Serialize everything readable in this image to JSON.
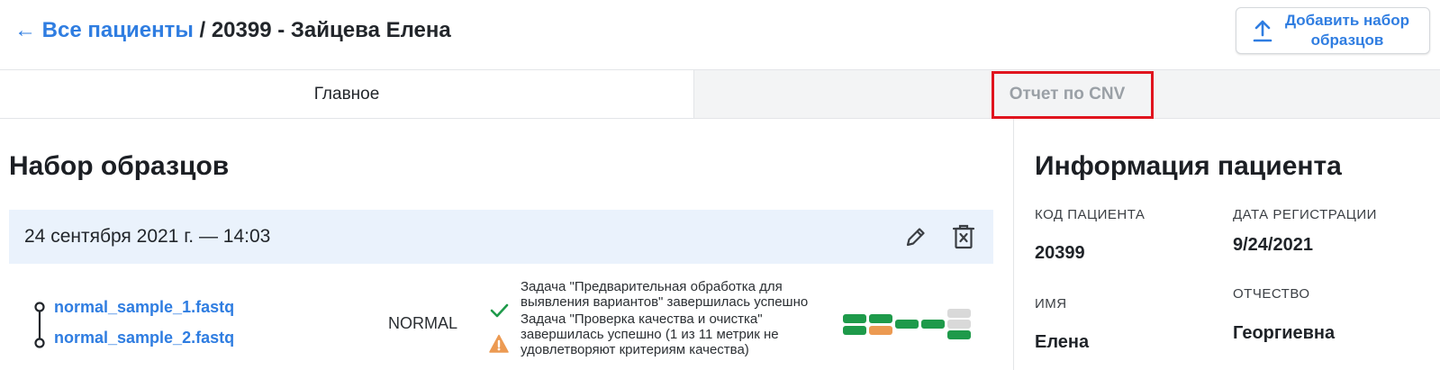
{
  "header": {
    "back_link": "← Все пациенты",
    "separator": " / ",
    "patient_title": "20399 - Зайцева Елена",
    "add_sample_set_button": "Добавить набор образцов"
  },
  "tabs": [
    {
      "label": "Главное",
      "active": true
    },
    {
      "label": "Отчет по CNV",
      "active": false
    }
  ],
  "sample_sets": {
    "title": "Набор образцов",
    "sets": [
      {
        "date": "24 сентября 2021 г. — 14:03",
        "files": [
          "normal_sample_1.fastq",
          "normal_sample_2.fastq"
        ],
        "sample_type": "NORMAL",
        "tasks": [
          {
            "status": "success",
            "icon": "check-icon",
            "text": "Задача \"Предварительная обработка для выявления вариантов\" завершилась успешно"
          },
          {
            "status": "warning",
            "icon": "warning-icon",
            "text": "Задача \"Проверка качества и очистка\" завершилась успешно (1 из 11 метрик не удовлетворяют критериям качества)"
          }
        ],
        "qc_metrics": [
          "pass",
          "pass",
          "pass",
          "warn",
          "pass",
          "pass",
          "na",
          "na",
          "pass",
          "pass",
          "pass"
        ]
      }
    ]
  },
  "patient_info": {
    "title": "Информация пациента",
    "fields": {
      "code": {
        "label": "КОД ПАЦИЕНТА",
        "value": "20399"
      },
      "registration_date": {
        "label": "ДАТА РЕГИСТРАЦИИ",
        "value": "9/24/2021"
      },
      "first_name": {
        "label": "ИМЯ",
        "value": "Елена"
      },
      "patronymic": {
        "label": "ОТЧЕСТВО",
        "value": "Георгиевна"
      }
    }
  },
  "colors": {
    "accent": "#2f7de1",
    "pass": "#1e9a4a",
    "warn": "#ec9a52",
    "na": "#d9d9d9",
    "highlight": "#e0141e"
  }
}
